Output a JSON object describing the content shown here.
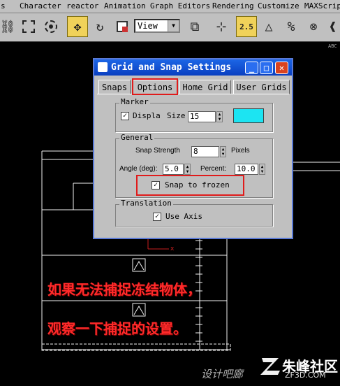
{
  "menu": {
    "items": [
      "s",
      "Character",
      "reactor",
      "Animation",
      "Graph Editors",
      "Rendering",
      "Customize",
      "MAXScript"
    ]
  },
  "toolbar": {
    "view_dropdown": "View",
    "snap_label": "2.5",
    "icons": [
      "link-icon",
      "select-region-icon",
      "lasso-icon",
      "move-icon",
      "rotate-icon",
      "scale-icon",
      "view-dropdown",
      "pivot-icon",
      "axis-icon",
      "snap-toggle-icon",
      "angle-snap-icon",
      "percent-snap-icon",
      "spinner-snap-icon",
      "named-selection-icon"
    ]
  },
  "viewport": {
    "corner_label": "ABC",
    "axis_label": "x"
  },
  "dialog": {
    "title": "Grid and Snap Settings",
    "tabs": [
      "Snaps",
      "Options",
      "Home Grid",
      "User Grids"
    ],
    "active_tab": "Options",
    "marker": {
      "group_label": "Marker",
      "display_label": "Displa",
      "size_label": "Size",
      "size_value": "15",
      "display_checked": true,
      "color": "#1ce4f2"
    },
    "general": {
      "group_label": "General",
      "snap_strength_label": "Snap Strength",
      "snap_strength_value": "8",
      "pixels_label": "Pixels",
      "angle_label": "Angle (deg):",
      "angle_value": "5.0",
      "percent_label": "Percent:",
      "percent_value": "10.0",
      "snap_to_frozen_label": "Snap to frozen",
      "snap_to_frozen_checked": true
    },
    "translation": {
      "group_label": "Translation",
      "use_axis_label": "Use Axis",
      "use_axis_checked": true
    }
  },
  "annotation": {
    "line1": "如果无法捕捉冻结物体，",
    "line2": "观察一下捕捉的设置。"
  },
  "watermark": {
    "site_cn": "设计吧廊",
    "brand_name": "朱峰社区",
    "brand_url": "ZF3D.COM"
  },
  "colors": {
    "highlight": "#e01b1b",
    "annotation": "#ff2a2a",
    "titlebar": "#0a3fc0"
  }
}
